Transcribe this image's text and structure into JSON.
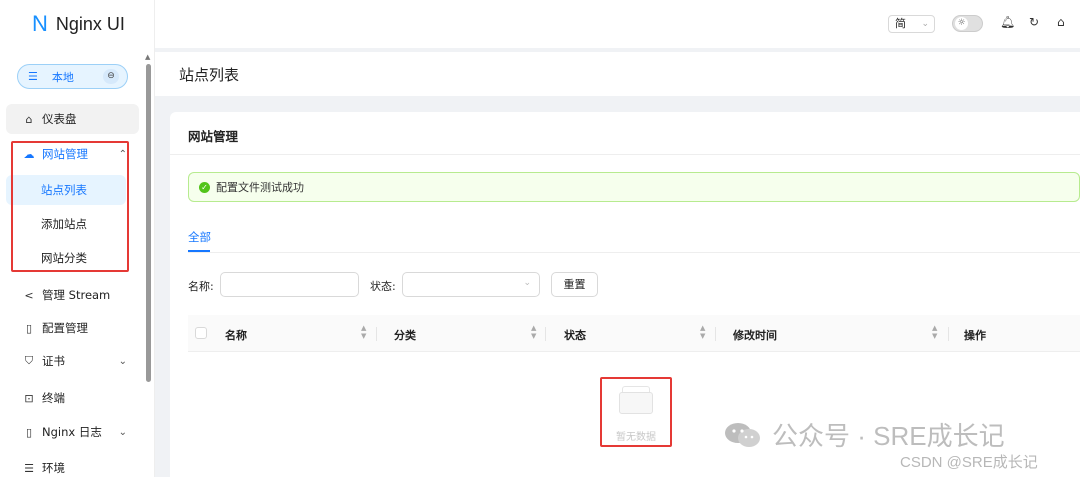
{
  "app": {
    "logo_letter": "N",
    "title": "Nginx UI"
  },
  "environment": {
    "label": "本地"
  },
  "sidebar": {
    "items": [
      {
        "label": "仪表盘",
        "icon": "home-icon"
      },
      {
        "label": "网站管理",
        "icon": "cloud-icon",
        "expanded": true,
        "children": [
          {
            "label": "站点列表",
            "active": true
          },
          {
            "label": "添加站点"
          },
          {
            "label": "网站分类"
          }
        ]
      },
      {
        "label": "管理 Stream",
        "icon": "share-icon"
      },
      {
        "label": "配置管理",
        "icon": "file-icon"
      },
      {
        "label": "证书",
        "icon": "shield-icon",
        "has_children": true
      },
      {
        "label": "终端",
        "icon": "terminal-icon"
      },
      {
        "label": "Nginx 日志",
        "icon": "file-text-icon",
        "has_children": true
      },
      {
        "label": "环境",
        "icon": "database-icon"
      }
    ]
  },
  "header": {
    "language": "简",
    "theme": "light"
  },
  "page": {
    "title": "站点列表"
  },
  "card": {
    "title": "网站管理",
    "alert": {
      "type": "success",
      "message": "配置文件测试成功"
    },
    "tabs": [
      {
        "label": "全部",
        "active": true
      }
    ],
    "filters": {
      "name_label": "名称:",
      "name_value": "",
      "status_label": "状态:",
      "status_value": "",
      "reset_label": "重置"
    },
    "table": {
      "columns": [
        "名称",
        "分类",
        "状态",
        "修改时间",
        "操作"
      ],
      "rows": [],
      "empty_text": "暂无数据"
    }
  },
  "watermarks": {
    "wechat": "公众号 · SRE成长记",
    "csdn": "CSDN @SRE成长记"
  },
  "colors": {
    "accent": "#1677ff",
    "success": "#52c41a",
    "highlight_box": "#e53935"
  }
}
